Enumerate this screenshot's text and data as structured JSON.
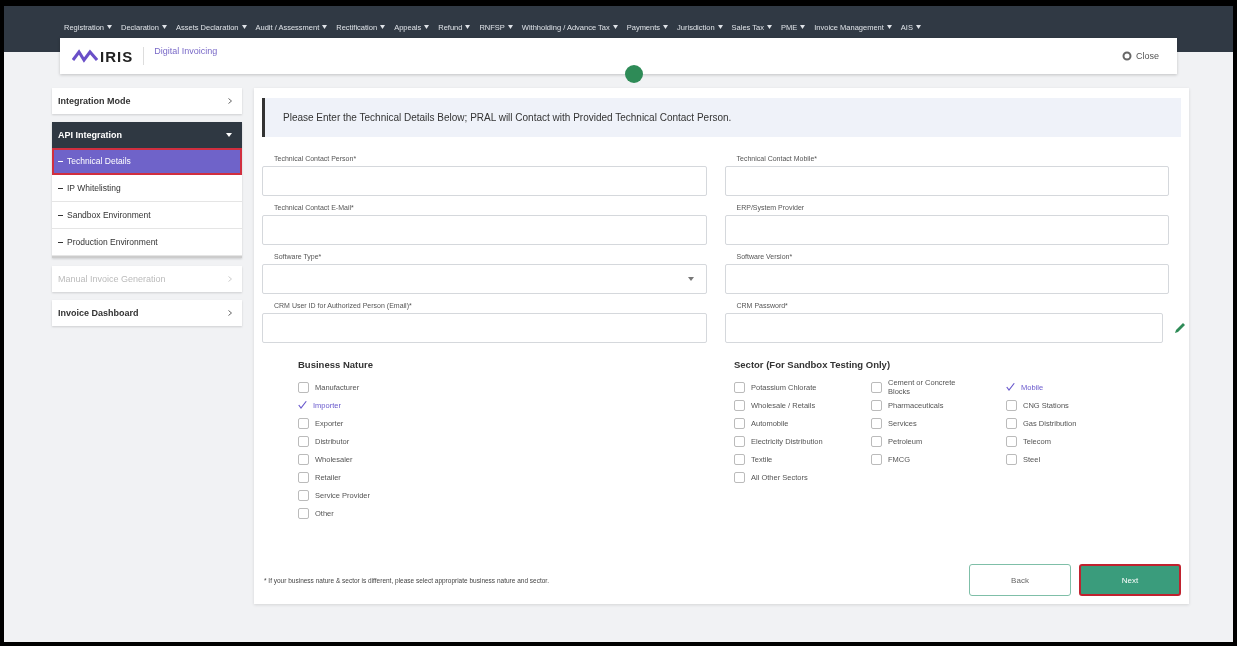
{
  "top_nav": [
    {
      "label": "Registration"
    },
    {
      "label": "Declaration"
    },
    {
      "label": "Assets Declaration"
    },
    {
      "label": "Audit / Assessment"
    },
    {
      "label": "Rectification"
    },
    {
      "label": "Appeals"
    },
    {
      "label": "Refund"
    },
    {
      "label": "RNFSP"
    },
    {
      "label": "Withholding / Advance Tax"
    },
    {
      "label": "Payments"
    },
    {
      "label": "Jurisdiction"
    },
    {
      "label": "Sales Tax"
    },
    {
      "label": "PME"
    },
    {
      "label": "Invoice Management"
    },
    {
      "label": "AIS"
    }
  ],
  "header": {
    "logo": "IRIS",
    "title": "Digital Invoicing",
    "close": "Close"
  },
  "sidebar": [
    {
      "label": "Integration Mode",
      "expanded": false,
      "disabled": false
    },
    {
      "label": "API Integration",
      "expanded": true,
      "disabled": false,
      "children": [
        {
          "label": "Technical Details",
          "selected": true
        },
        {
          "label": "IP Whitelisting",
          "selected": false
        },
        {
          "label": "Sandbox Environment",
          "selected": false
        },
        {
          "label": "Production Environment",
          "selected": false
        }
      ]
    },
    {
      "label": "Manual Invoice Generation",
      "expanded": false,
      "disabled": true
    },
    {
      "label": "Invoice Dashboard",
      "expanded": false,
      "disabled": false
    }
  ],
  "notice": "Please Enter the Technical Details Below; PRAL will Contact with Provided Technical Contact Person.",
  "fields": [
    {
      "label": "Technical Contact Person*",
      "kind": "text"
    },
    {
      "label": "Technical Contact Mobile*",
      "kind": "text"
    },
    {
      "label": "Technical Contact E-Mail*",
      "kind": "text"
    },
    {
      "label": "ERP/System Provider",
      "kind": "text"
    },
    {
      "label": "Software Type*",
      "kind": "select"
    },
    {
      "label": "Software Version*",
      "kind": "text"
    },
    {
      "label": "CRM User ID for Authorized Person (Email)*",
      "kind": "text"
    },
    {
      "label": "CRM Password*",
      "kind": "password"
    }
  ],
  "business_nature": {
    "title": "Business Nature",
    "options": [
      {
        "label": "Manufacturer",
        "checked": false
      },
      {
        "label": "Importer",
        "checked": true
      },
      {
        "label": "Exporter",
        "checked": false
      },
      {
        "label": "Distributor",
        "checked": false
      },
      {
        "label": "Wholesaler",
        "checked": false
      },
      {
        "label": "Retailer",
        "checked": false
      },
      {
        "label": "Service Provider",
        "checked": false
      },
      {
        "label": "Other",
        "checked": false
      }
    ]
  },
  "sector": {
    "title": "Sector (For Sandbox Testing Only)",
    "columns": [
      [
        {
          "label": "Potassium Chlorate",
          "checked": false
        },
        {
          "label": "Wholesale / Retails",
          "checked": false
        },
        {
          "label": "Automobile",
          "checked": false
        },
        {
          "label": "Electricity Distribution",
          "checked": false
        },
        {
          "label": "Textile",
          "checked": false
        },
        {
          "label": "All Other Sectors",
          "checked": false
        }
      ],
      [
        {
          "label": "Cement or Concrete Blocks",
          "checked": false
        },
        {
          "label": "Pharmaceuticals",
          "checked": false
        },
        {
          "label": "Services",
          "checked": false
        },
        {
          "label": "Petroleum",
          "checked": false
        },
        {
          "label": "FMCG",
          "checked": false
        }
      ],
      [
        {
          "label": "Mobile",
          "checked": true
        },
        {
          "label": "CNG Stations",
          "checked": false
        },
        {
          "label": "Gas Distribution",
          "checked": false
        },
        {
          "label": "Telecom",
          "checked": false
        },
        {
          "label": "Steel",
          "checked": false
        }
      ]
    ]
  },
  "footnote": "* If your business nature & sector is different, please select appropriate business nature and sector.",
  "buttons": {
    "back": "Back",
    "next": "Next"
  }
}
